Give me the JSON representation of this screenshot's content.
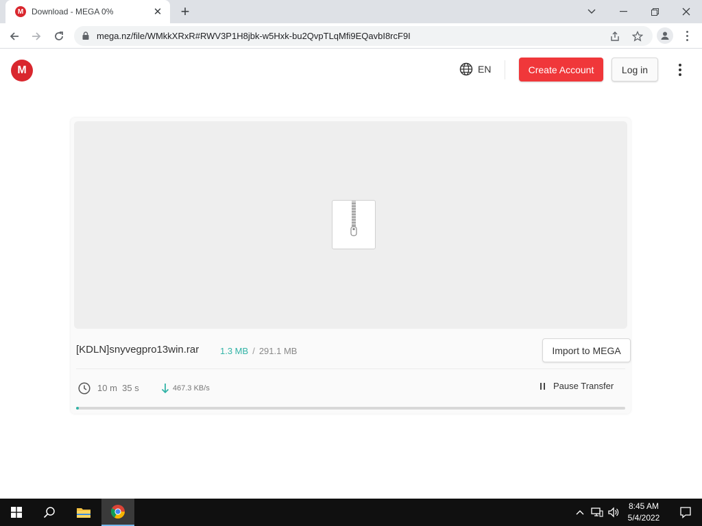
{
  "browser": {
    "tab_title": "Download - MEGA 0%",
    "tab_favicon": "M",
    "url": "mega.nz/file/WMkkXRxR#RWV3P1H8jbk-w5Hxk-bu2QvpTLqMfi9EQavbI8rcF9I",
    "window_controls": [
      "chevron-down",
      "minimize",
      "restore",
      "close"
    ]
  },
  "header": {
    "logo": "M",
    "language": "EN",
    "create_account": "Create Account",
    "login": "Log in"
  },
  "download": {
    "file_name": "[KDLN]snyvegpro13win.rar",
    "downloaded": "1.3 MB",
    "separator": "/",
    "total_size": "291.1 MB",
    "import_label": "Import to MEGA",
    "time_left_minutes": "10 m",
    "time_left_seconds": "35 s",
    "speed": "467.3 KB/s",
    "pause_label": "Pause Transfer",
    "progress_fraction": 0.0045
  },
  "taskbar": {
    "time": "8:45 AM",
    "date": "5/4/2022",
    "apps": [
      "start",
      "search",
      "file-explorer",
      "chrome"
    ]
  },
  "colors": {
    "mega_red": "#d9272e",
    "create_button": "#f0373a",
    "progress": "#31b3a6"
  }
}
